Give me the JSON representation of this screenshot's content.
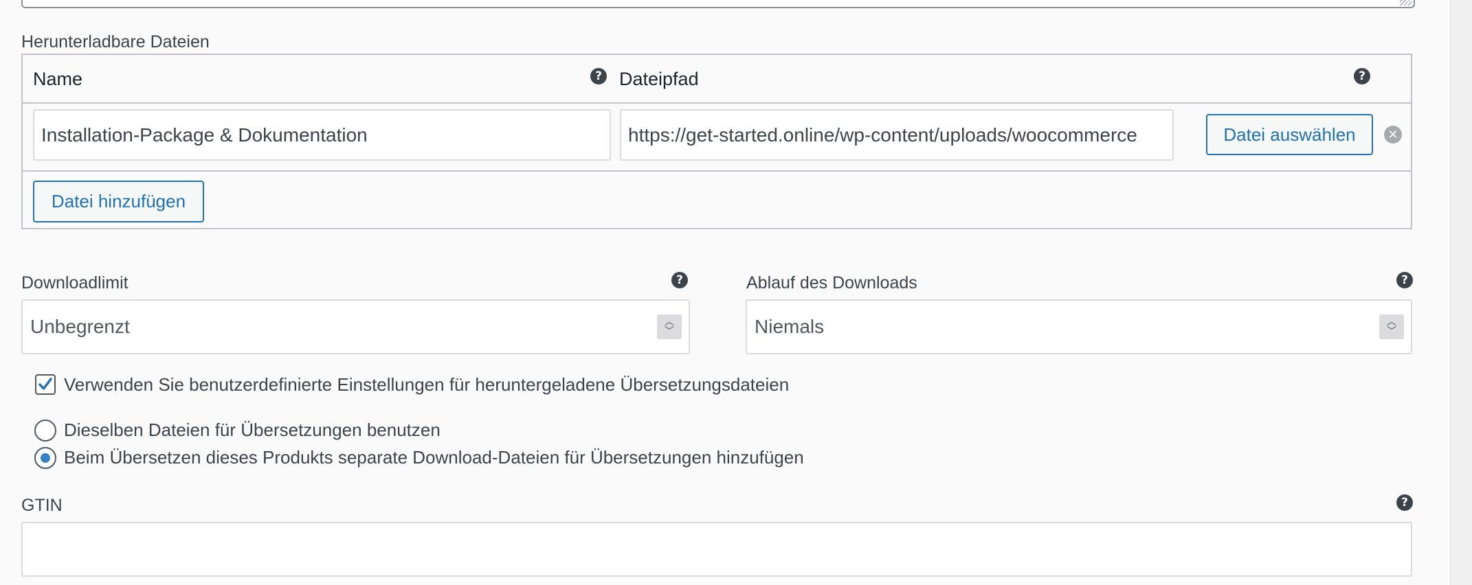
{
  "downloadable_files": {
    "section_label": "Herunterladbare Dateien",
    "col_name": "Name",
    "col_path": "Dateipfad",
    "help_glyph": "?",
    "row": {
      "name_value": "Installation-Package & Dokumentation",
      "path_value": "https://get-started.online/wp-content/uploads/woocommerce",
      "choose_file_label": "Datei auswählen",
      "remove_glyph": "✕"
    },
    "add_file_label": "Datei hinzufügen"
  },
  "download_limit": {
    "label": "Downloadlimit",
    "placeholder": "Unbegrenzt"
  },
  "download_expiry": {
    "label": "Ablauf des Downloads",
    "placeholder": "Niemals"
  },
  "translation_settings": {
    "custom_checkbox_label": "Verwenden Sie benutzerdefinierte Einstellungen für heruntergeladene Übersetzungsdateien",
    "custom_checked": true,
    "options": [
      {
        "label": "Dieselben Dateien für Übersetzungen benutzen",
        "selected": false
      },
      {
        "label": "Beim Übersetzen dieses Produkts separate Download-Dateien für Übersetzungen hinzufügen",
        "selected": true
      }
    ]
  },
  "gtin": {
    "label": "GTIN",
    "value": ""
  },
  "colors": {
    "accent": "#2271b1",
    "radio_selected": "#3582c4",
    "text": "#3c434a"
  },
  "icons": {
    "help": "help-icon",
    "remove": "remove-file-icon",
    "check": "checkmark-icon",
    "spinner": "spinner-arrows-icon"
  }
}
